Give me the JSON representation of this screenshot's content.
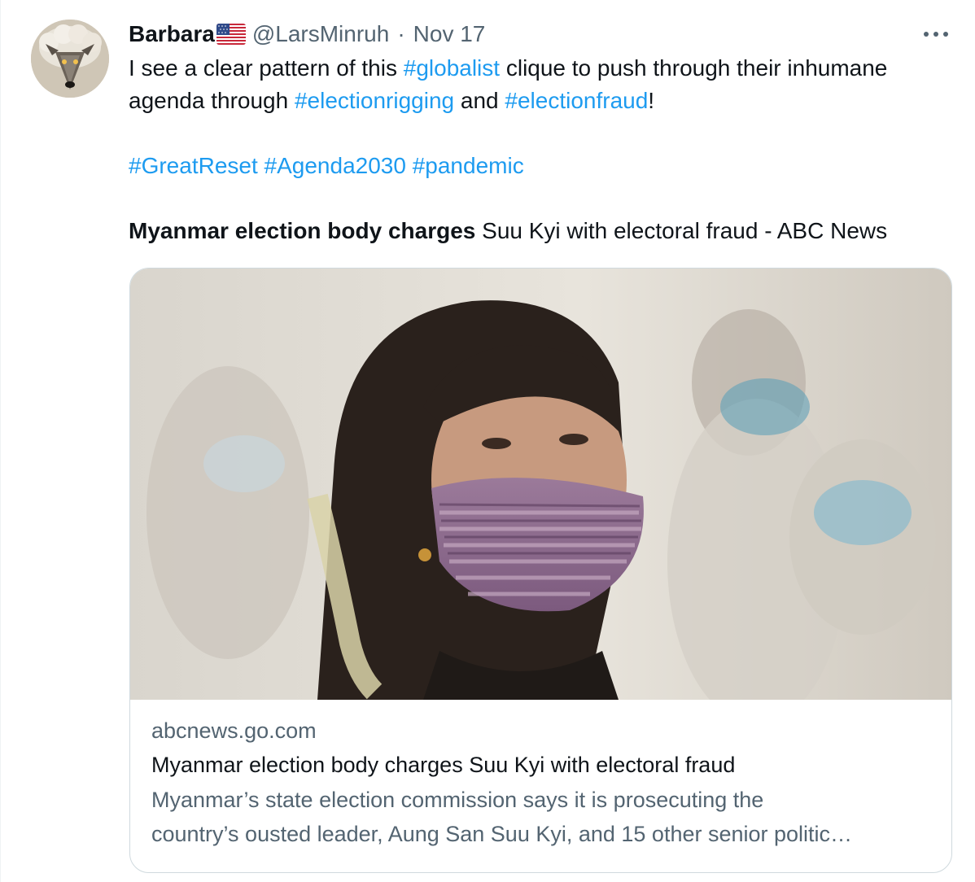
{
  "tweet": {
    "display_name": "Barbara",
    "handle": "@LarsMinruh",
    "separator": "·",
    "date": "Nov 17",
    "more_label": "···",
    "line1_pre": "I see a clear pattern of this ",
    "tag_globalist": "#globalist",
    "line1_post": " clique to push through their inhumane",
    "line2_pre": "agenda through ",
    "tag_electionrigging": "#electionrigging",
    "line2_mid": " and ",
    "tag_electionfraud": "#electionfraud",
    "line2_post": "!",
    "tag_greatreset": "#GreatReset",
    "tag_agenda2030": "#Agenda2030",
    "tag_pandemic": "#pandemic",
    "headline_bold": "Myanmar election body charges",
    "headline_rest": " Suu Kyi with electoral fraud - ABC News"
  },
  "card": {
    "domain": "abcnews.go.com",
    "title": "Myanmar election body charges Suu Kyi with electoral fraud",
    "description_line1": "Myanmar’s state election commission says it is prosecuting the",
    "description_line2": "country’s ousted leader, Aung San Suu Kyi, and 15 other senior politic…"
  },
  "colors": {
    "hashtag": "#1d9bf0",
    "secondary_text": "#536471",
    "card_border": "#cfd9de"
  },
  "icons": {
    "flag": "us-flag-icon",
    "more": "more-options-icon",
    "avatar": "wolf-in-sheep-avatar"
  }
}
